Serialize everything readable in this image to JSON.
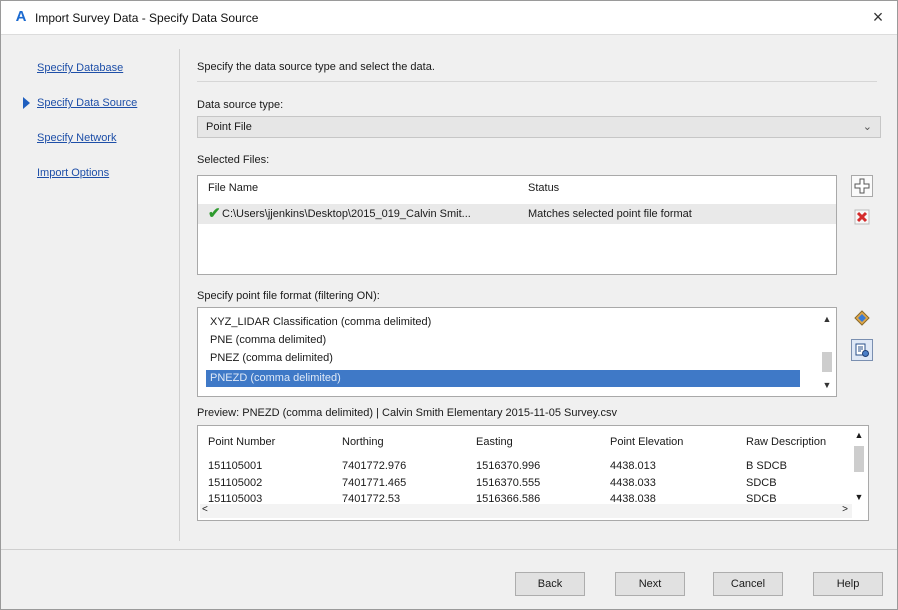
{
  "window": {
    "title": "Import Survey Data - Specify Data Source",
    "app_icon_glyph": "A",
    "close_glyph": "×"
  },
  "nav": {
    "items": [
      {
        "label": "Specify Database",
        "active": false
      },
      {
        "label": "Specify Data Source",
        "active": true
      },
      {
        "label": "Specify Network",
        "active": false
      },
      {
        "label": "Import Options",
        "active": false
      }
    ]
  },
  "main": {
    "instruction": "Specify the data source type and select the data.",
    "data_source_label": "Data source type:",
    "data_source_value": "Point File",
    "selected_files_label": "Selected Files:",
    "files_columns": [
      "File Name",
      "Status"
    ],
    "files": [
      {
        "name": "C:\\Users\\jjenkins\\Desktop\\2015_019_Calvin Smit...",
        "status": "Matches selected point file format"
      }
    ],
    "format_label": "Specify point file format (filtering ON):",
    "formats": [
      {
        "label": "XYZ_LIDAR Classification (comma delimited)",
        "selected": false
      },
      {
        "label": "PNE (comma delimited)",
        "selected": false
      },
      {
        "label": "PNEZ (comma delimited)",
        "selected": false
      },
      {
        "label": "PNEZD (comma delimited)",
        "selected": true
      }
    ],
    "preview_label": "Preview: PNEZD (comma delimited) | Calvin Smith Elementary 2015-11-05 Survey.csv",
    "preview_columns": [
      "Point Number",
      "Northing",
      "Easting",
      "Point Elevation",
      "Raw Description"
    ],
    "preview_rows": [
      [
        "151105001",
        "7401772.976",
        "1516370.996",
        "4438.013",
        "B SDCB"
      ],
      [
        "151105002",
        "7401771.465",
        "1516370.555",
        "4438.033",
        "SDCB"
      ],
      [
        "151105003",
        "7401772.53",
        "1516366.586",
        "4438.038",
        "SDCB"
      ]
    ]
  },
  "footer": {
    "back": "Back",
    "next": "Next",
    "cancel": "Cancel",
    "help": "Help"
  },
  "colors": {
    "link": "#1e4fa8",
    "selection": "#3f79c7",
    "check": "#2e9a2e",
    "remove": "#d42b2b"
  },
  "icons": {
    "add": "add-file-icon",
    "remove": "remove-file-icon",
    "format_up": "format-options-icon",
    "format_manager": "format-manager-icon"
  }
}
